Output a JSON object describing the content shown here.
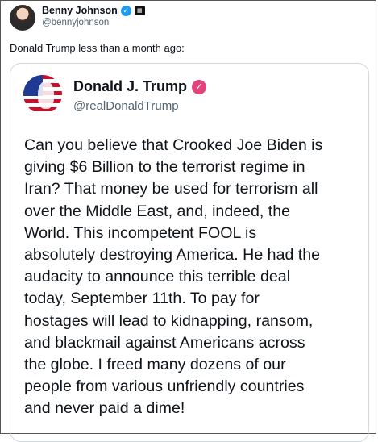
{
  "outer": {
    "name": "Benny Johnson",
    "handle": "@bennyjohnson",
    "text": "Donald Trump less than a month ago:"
  },
  "quoted": {
    "name": "Donald J. Trump",
    "handle": "@realDonaldTrump",
    "body": "Can you believe that Crooked Joe Biden is\ngiving $6 Billion to the terrorist regime in\nIran? That money be used for terrorism all\nover the Middle East, and, indeed, the\nWorld. This incompetent FOOL is\nabsolutely destroying America. He had the\naudacity to announce this terrible deal\ntoday, September 11th. To pay for\nhostages will lead to kidnapping, ransom,\nand blackmail against Americans across\nthe globe. I freed many dozens of our\npeople from various unfriendly countries\nand never paid a dime!"
  },
  "colors": {
    "verified_blue": "#1d9bf0",
    "verified_pink": "#e0447b",
    "handle_gray": "#536471",
    "card_border": "#cfd9de"
  }
}
